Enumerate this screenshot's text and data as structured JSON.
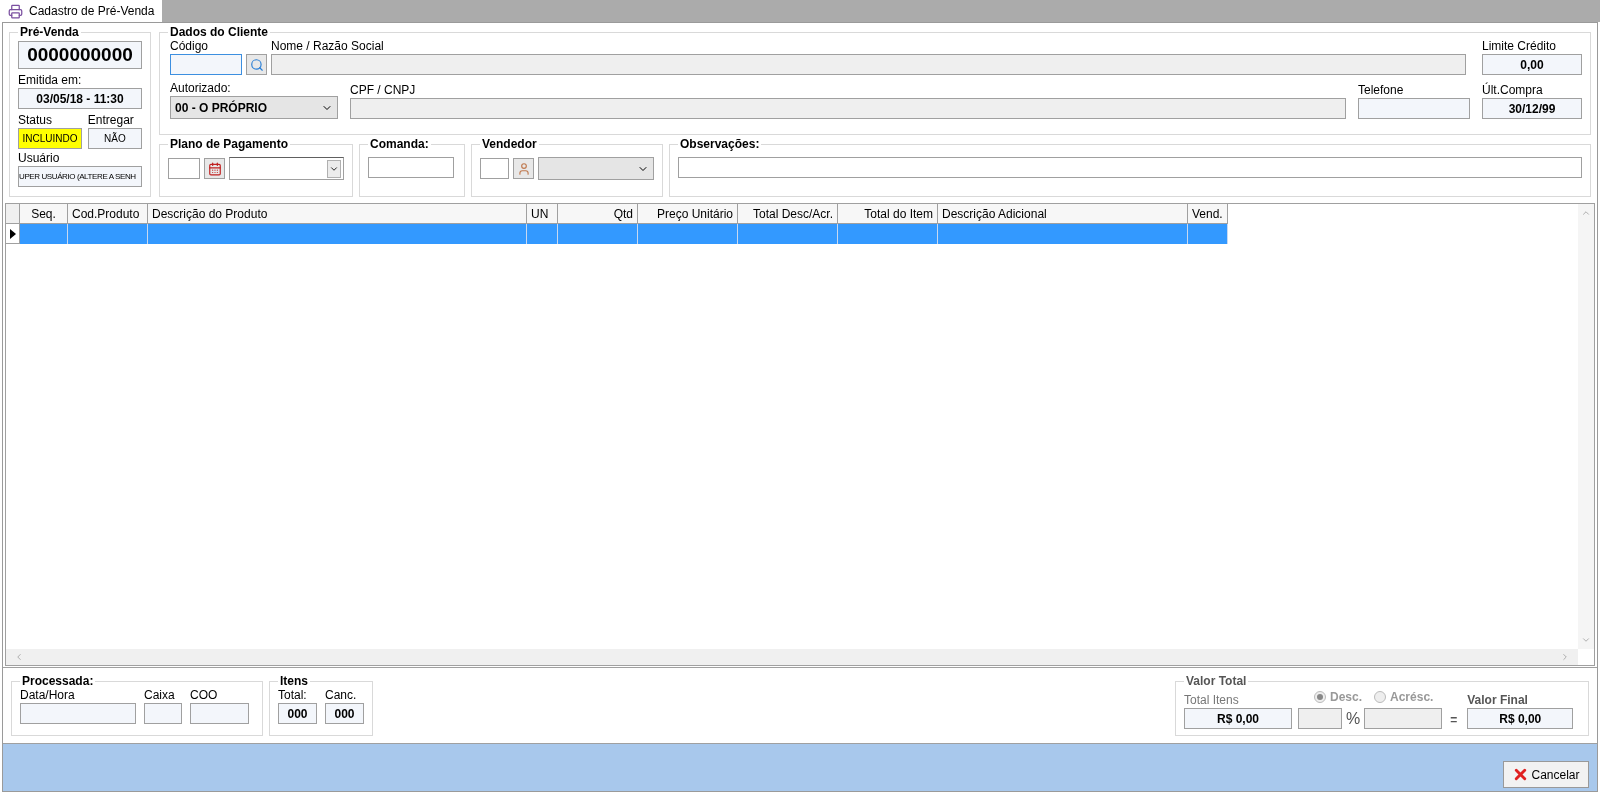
{
  "tab": {
    "title": "Cadastro de Pré-Venda",
    "selected": true
  },
  "pre_venda": {
    "title": "Pré-Venda",
    "number": "0000000000",
    "emitida_label": "Emitida em:",
    "emitida": "03/05/18 - 11:30",
    "status_label": "Status",
    "status": {
      "text": "INCLUINDO",
      "color": "#ffff00"
    },
    "entregar_label": "Entregar",
    "entregar": "NÃO",
    "usuario_label": "Usuário",
    "usuario": "UPER USUÁRIO (ALTERE A SENH"
  },
  "cliente": {
    "title": "Dados do Cliente",
    "codigo_label": "Código",
    "nome_label": "Nome / Razão Social",
    "limite_label": "Limite Crédito",
    "limite": "0,00",
    "autorizado_label": "Autorizado:",
    "autorizado": "00 - O PRÓPRIO",
    "cpf_label": "CPF / CNPJ",
    "telefone_label": "Telefone",
    "ult_compra_label": "Últ.Compra",
    "ult_compra": "30/12/99"
  },
  "plano": {
    "title": "Plano de Pagamento"
  },
  "comanda": {
    "title": "Comanda:"
  },
  "vendedor": {
    "title": "Vendedor"
  },
  "observacoes": {
    "title": "Observações:"
  },
  "grid": {
    "columns": [
      {
        "label": "Seq."
      },
      {
        "label": "Cod.Produto"
      },
      {
        "label": "Descrição do Produto"
      },
      {
        "label": "UN"
      },
      {
        "label": "Qtd"
      },
      {
        "label": "Preço Unitário"
      },
      {
        "label": "Total Desc/Acr."
      },
      {
        "label": "Total do Item"
      },
      {
        "label": "Descrição Adicional"
      },
      {
        "label": "Vend."
      }
    ],
    "rows": [
      {
        "selected": true
      }
    ]
  },
  "processada": {
    "title": "Processada:",
    "data_label": "Data/Hora",
    "caixa_label": "Caixa",
    "coo_label": "COO"
  },
  "itens": {
    "title": "Itens",
    "total_label": "Total:",
    "total": "000",
    "canc_label": "Canc.",
    "canc": "000"
  },
  "valor_total": {
    "title": "Valor Total",
    "total_itens_label": "Total Itens",
    "total_itens": "R$ 0,00",
    "radios": [
      {
        "label": "Desc.",
        "selected": true
      },
      {
        "label": "Acrésc.",
        "selected": false
      }
    ],
    "percent": "%",
    "equals": "=",
    "final_label": "Valor Final",
    "final": "R$ 0,00"
  },
  "cancel_button": "Cancelar"
}
